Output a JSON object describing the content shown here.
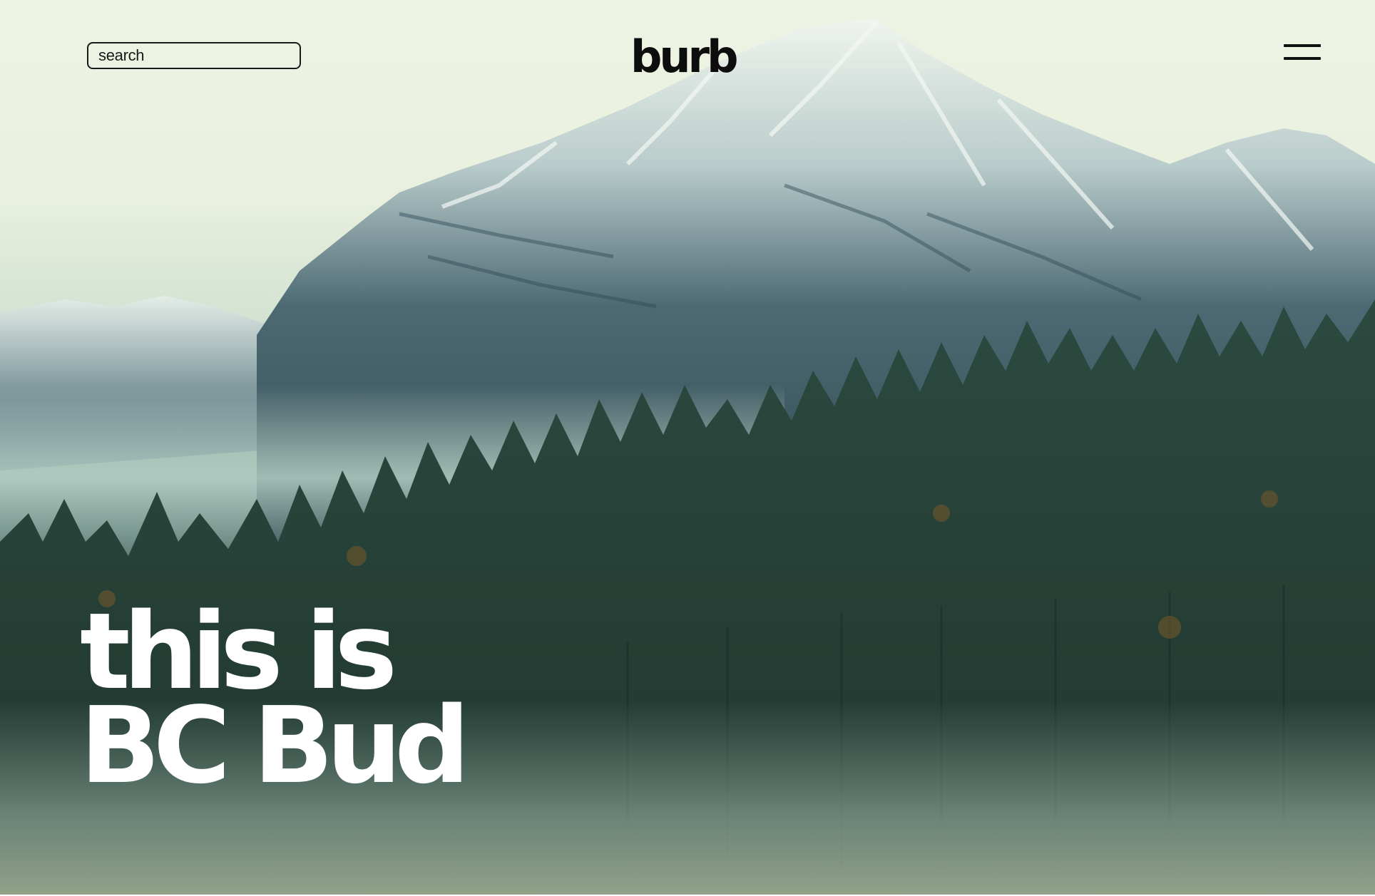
{
  "header": {
    "search": {
      "placeholder": "search",
      "value": ""
    },
    "logo": "burb",
    "menu_icon": "hamburger-menu-icon"
  },
  "hero": {
    "headline_line1": "this is",
    "headline_line2": "BC Bud",
    "headline_color": "#ffffff"
  },
  "colors": {
    "sky": "#eef4e4",
    "mountain": "#4b6470",
    "forest": "#2a4136",
    "text_dark": "#0d0d0d"
  }
}
